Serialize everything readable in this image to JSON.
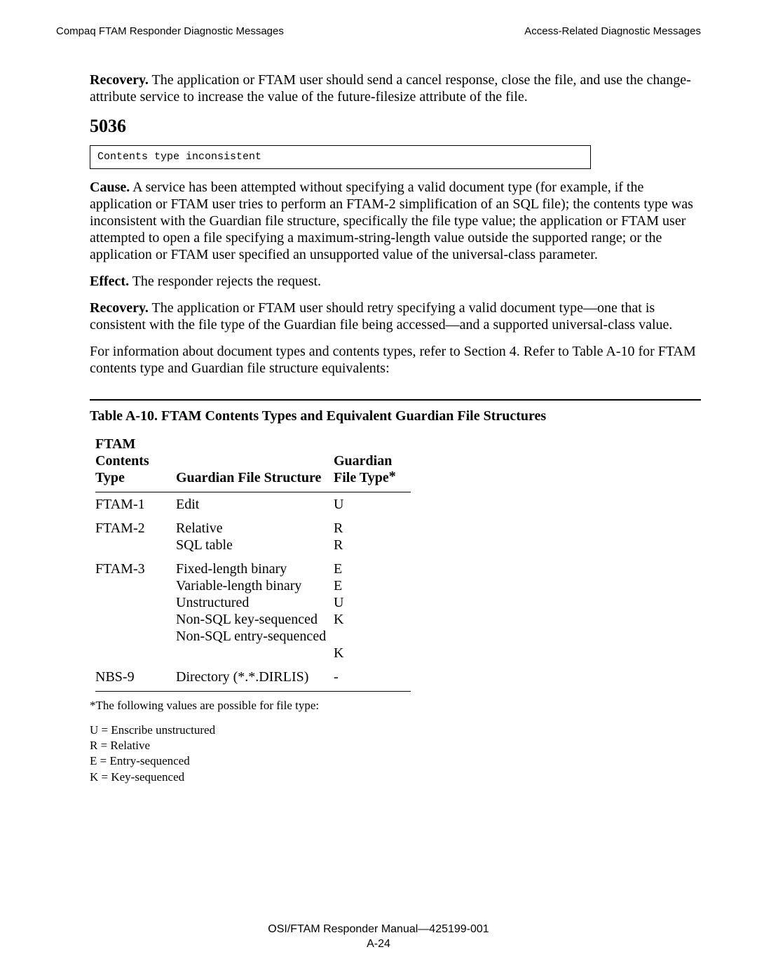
{
  "header": {
    "left": "Compaq FTAM Responder Diagnostic Messages",
    "right": "Access-Related Diagnostic Messages"
  },
  "intro": {
    "recovery_label": "Recovery.",
    "recovery_text": "  The application or FTAM user should send a cancel response, close the file, and use the change-attribute service to increase the value of the future-filesize attribute of the file."
  },
  "section_num": "5036",
  "msg_box": "Contents type inconsistent",
  "cause_label": "Cause.",
  "cause_text": "  A service has been attempted without specifying a valid document type (for example, if the application or FTAM user tries to perform an FTAM-2 simplification of an SQL file); the contents type was inconsistent with the Guardian file structure, specifically the file type value; the application or FTAM user attempted to open a file specifying a maximum-string-length value outside the supported range; or the application or FTAM user specified an unsupported value of the universal-class parameter.",
  "effect_label": "Effect.",
  "effect_text": "  The responder rejects the request.",
  "recovery2_label": "Recovery.",
  "recovery2_text": "  The application or FTAM user should retry specifying a valid document type—one that is consistent with the file type of the Guardian file being accessed—and a supported universal-class value.",
  "more_info": "For information about document types and contents types, refer to Section 4.  Refer to Table A-10 for FTAM contents type and Guardian file structure equivalents:",
  "table_title": "Table A-10.  FTAM Contents Types and Equivalent Guardian File Structures",
  "table": {
    "head_a1": "FTAM",
    "head_a2": "Contents",
    "head_a3": "Type",
    "head_b": "Guardian File Structure",
    "head_c1": "Guardian",
    "head_c2": "File Type",
    "rows": [
      {
        "a": "FTAM-1",
        "b": "Edit",
        "c": "U"
      },
      {
        "a": "FTAM-2",
        "b": "Relative\nSQL table",
        "c": "R\nR"
      },
      {
        "a": "FTAM-3",
        "b": "Fixed-length binary\nVariable-length binary\nUnstructured\nNon-SQL key-sequenced\nNon-SQL entry-sequenced",
        "c": "E\nE\nU\nK\n\nK"
      },
      {
        "a": "NBS-9",
        "b": "Directory (*.*.DIRLIS)",
        "c": "-"
      }
    ]
  },
  "footnote_lead": "*The following values are possible for file type:",
  "footnote_U": "U = Enscribe unstructured",
  "footnote_R": "R = Relative",
  "footnote_E": "E = Entry-sequenced",
  "footnote_K": "K = Key-sequenced",
  "footer_main": "OSI/FTAM Responder Manual—425199-001",
  "footer_sub": "A-24"
}
